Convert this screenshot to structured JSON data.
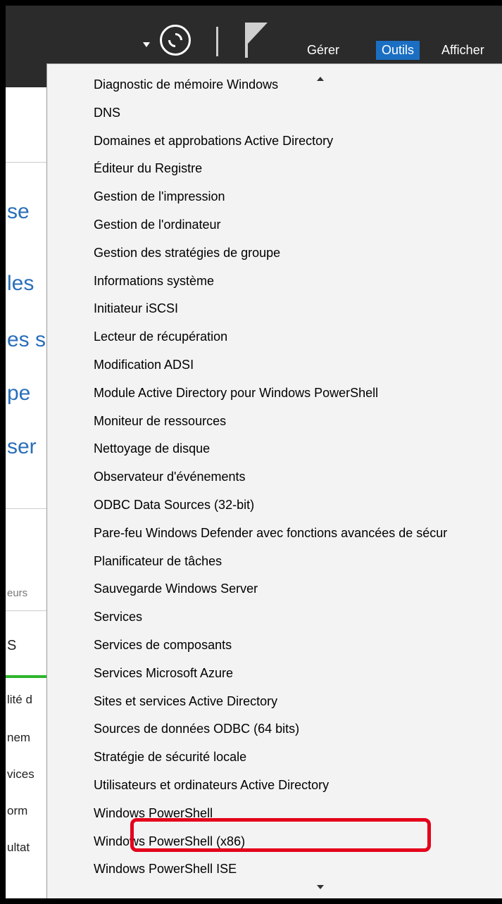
{
  "toolbar": {
    "menus": [
      "Gérer",
      "Outils",
      "Afficher"
    ],
    "active_menu": "Outils"
  },
  "left_pane": {
    "fragments": [
      "se",
      "les",
      "es s",
      "pe",
      "ser",
      "eurs",
      "S",
      "lité d",
      "nem",
      "vices",
      "orm",
      "ultat"
    ]
  },
  "tools_menu": {
    "items": [
      "Diagnostic de mémoire Windows",
      "DNS",
      "Domaines et approbations Active Directory",
      "Éditeur du Registre",
      "Gestion de l'impression",
      "Gestion de l'ordinateur",
      "Gestion des stratégies de groupe",
      "Informations système",
      "Initiateur iSCSI",
      "Lecteur de récupération",
      "Modification ADSI",
      "Module Active Directory pour Windows PowerShell",
      "Moniteur de ressources",
      "Nettoyage de disque",
      "Observateur d'événements",
      "ODBC Data Sources (32-bit)",
      "Pare-feu Windows Defender avec fonctions avancées de sécur",
      "Planificateur de tâches",
      "Sauvegarde Windows Server",
      "Services",
      "Services de composants",
      "Services Microsoft Azure",
      "Sites et services Active Directory",
      "Sources de données ODBC (64 bits)",
      "Stratégie de sécurité locale",
      "Utilisateurs et ordinateurs Active Directory",
      "Windows PowerShell",
      "Windows PowerShell (x86)",
      "Windows PowerShell ISE"
    ],
    "highlighted_item": "Utilisateurs et ordinateurs Active Directory",
    "highlight_color": "#e3001b"
  }
}
